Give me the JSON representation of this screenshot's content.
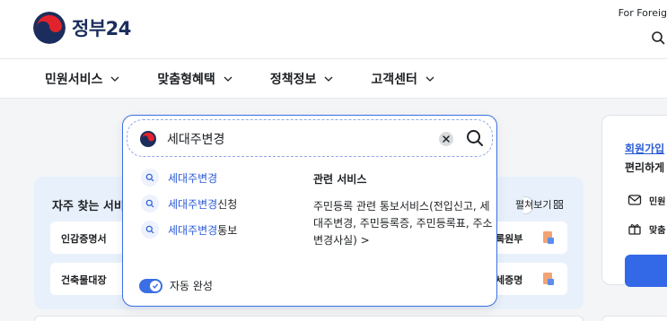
{
  "header": {
    "logo_text": "정부",
    "logo_number": "24",
    "lang_link": "For Foreig"
  },
  "nav": {
    "items": [
      {
        "label": "민원서비스"
      },
      {
        "label": "맞춤형혜택"
      },
      {
        "label": "정책정보"
      },
      {
        "label": "고객센터"
      }
    ]
  },
  "search": {
    "query": "세대주변경",
    "suggestions": [
      {
        "highlight": "세대주변경",
        "rest": ""
      },
      {
        "highlight": "세대주변경",
        "rest": "신청"
      },
      {
        "highlight": "세대주변경",
        "rest": "통보"
      }
    ],
    "related_title": "관련 서비스",
    "related_desc": "주민등록 관련 통보서비스(전입신고, 세대주변경, 주민등록증, 주민등록표, 주소변경사실) >",
    "autocomplete_label": "자동 완성",
    "autocomplete_on": true
  },
  "faq": {
    "title": "자주 찾는 서비",
    "expand_label": "펼쳐보기",
    "cards": [
      {
        "label": "인감증명서"
      },
      {
        "label": "록원부"
      },
      {
        "label": "건축물대장"
      },
      {
        "label": "세증명"
      }
    ]
  },
  "side": {
    "link": "회원가입",
    "subtitle": "편리하게",
    "rows": [
      {
        "label": "민원"
      },
      {
        "label": "맞춤"
      }
    ]
  },
  "colors": {
    "accent": "#3b6fe3",
    "highlight_text": "#2b5bd7",
    "faq_bg": "#e8f1fb",
    "brand_navy": "#1b2d5c"
  }
}
